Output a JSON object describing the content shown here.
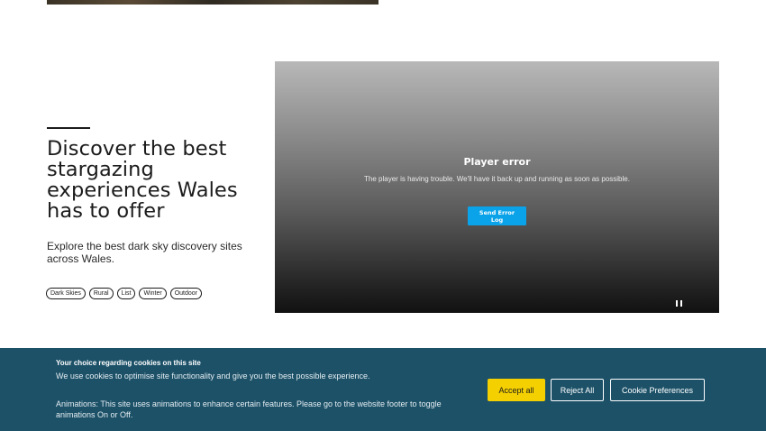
{
  "article": {
    "headline": "Discover the best stargazing experiences Wales has to offer",
    "intro": "Explore the best dark sky discovery sites across Wales.",
    "tags": [
      "Dark Skies",
      "Rural",
      "List",
      "Winter",
      "Outdoor"
    ]
  },
  "player": {
    "error_title": "Player error",
    "error_message": "The player is having trouble. We'll have it back up and running as soon as possible.",
    "send_log_label": "Send Error Log",
    "pause_icon": "pause-icon",
    "accent_color": "#0aa2e8"
  },
  "cookies": {
    "title": "Your choice regarding cookies on this site",
    "text": "We use cookies to optimise site functionality and give you the best possible experience.",
    "animations_note": "Animations: This site uses animations to enhance certain features. Please go to the website footer to toggle animations On or Off.",
    "accept_label": "Accept all",
    "reject_label": "Reject All",
    "prefs_label": "Cookie Preferences",
    "banner_color": "#1c5168",
    "accept_color": "#f5d000"
  }
}
